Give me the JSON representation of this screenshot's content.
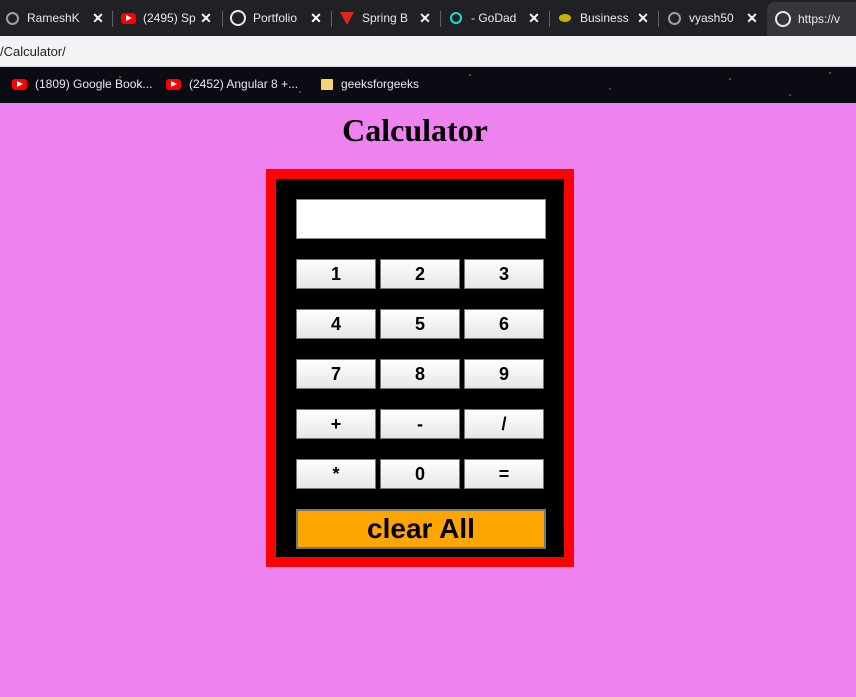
{
  "browser": {
    "tabs": [
      {
        "title": "RameshK",
        "icon": "github-icon"
      },
      {
        "title": "(2495) Sp",
        "icon": "youtube-icon"
      },
      {
        "title": "Portfolio",
        "icon": "globe-icon"
      },
      {
        "title": "Spring B",
        "icon": "vuetify-icon"
      },
      {
        "title": "- GoDad",
        "icon": "godaddy-icon"
      },
      {
        "title": "Business",
        "icon": "bee-icon"
      },
      {
        "title": "vyash50",
        "icon": "github-icon"
      },
      {
        "title": "https://v",
        "icon": "globe-icon",
        "active": true
      }
    ],
    "close_glyph": "✕",
    "address": "/Calculator/",
    "bookmarks": [
      {
        "label": "(1809) Google Book...",
        "icon": "youtube-icon"
      },
      {
        "label": "(2452) Angular 8 +...",
        "icon": "youtube-icon"
      },
      {
        "label": "geeksforgeeks",
        "icon": "folder-icon"
      }
    ]
  },
  "page": {
    "title": "Calculator",
    "display_value": "",
    "keys": [
      [
        "1",
        "2",
        "3"
      ],
      [
        "4",
        "5",
        "6"
      ],
      [
        "7",
        "8",
        "9"
      ],
      [
        "+",
        "-",
        "/"
      ],
      [
        "*",
        "0",
        "="
      ]
    ],
    "clear_label": "clear All"
  },
  "colors": {
    "page_background": "#ee82ee",
    "calculator_border": "#ff0000",
    "calculator_body": "#000000",
    "clear_button": "#ffa500"
  }
}
